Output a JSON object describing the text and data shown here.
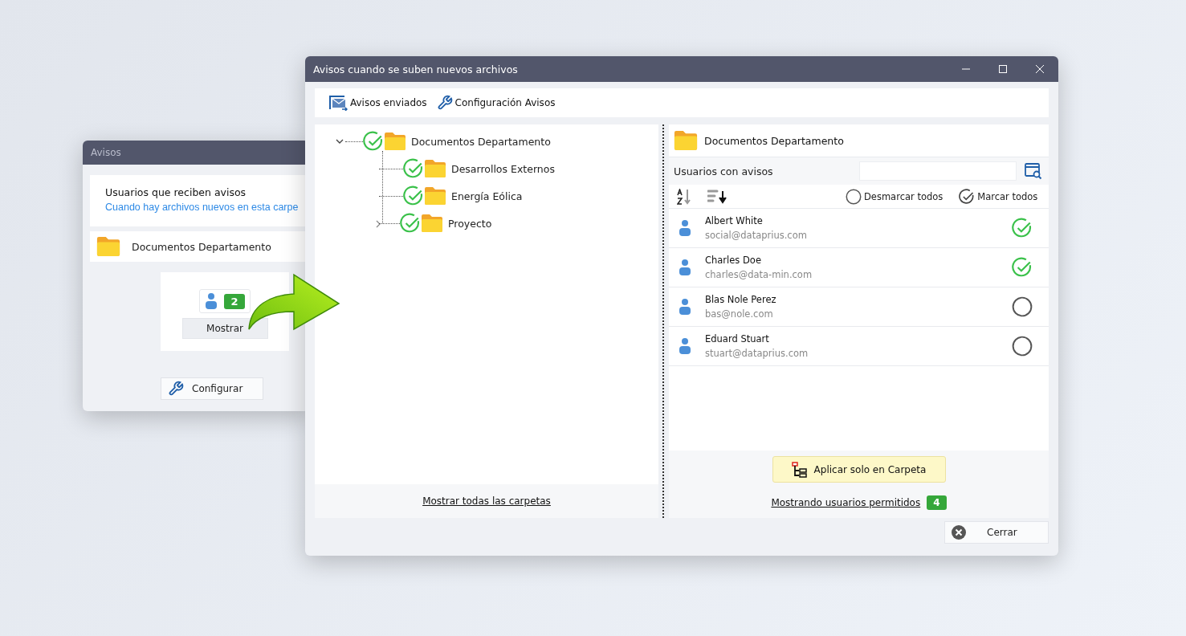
{
  "back_window": {
    "title": "Avisos",
    "heading": "Usuarios que reciben avisos",
    "subtitle": "Cuando hay archivos nuevos en esta carpe",
    "folder": "Documentos Departamento",
    "user_count": "2",
    "show_button": "Mostrar",
    "configure_button": "Configurar"
  },
  "window": {
    "title": "Avisos cuando se suben nuevos archivos"
  },
  "toolbar": [
    {
      "kind": "mail",
      "label": "Avisos enviados"
    },
    {
      "kind": "wrench",
      "label": "Configuración Avisos"
    }
  ],
  "tree": {
    "label": "Documentos Departamento",
    "checked": true,
    "has_children": true,
    "expanded": true,
    "children": [
      {
        "label": "Desarrollos Externos",
        "checked": true,
        "has_children": false,
        "expanded": false
      },
      {
        "label": "Energía Eólica",
        "checked": true,
        "has_children": false,
        "expanded": false
      },
      {
        "label": "Proyecto",
        "checked": true,
        "has_children": true,
        "expanded": false
      }
    ]
  },
  "show_all_link": "Mostrar todas las carpetas",
  "users_panel": {
    "folder": "Documentos Departamento",
    "label": "Usuarios con avisos",
    "uncheck_all": "Desmarcar todos",
    "check_all": "Marcar todos",
    "users": [
      {
        "name": "Albert White",
        "email": "social@dataprius.com",
        "checked": true
      },
      {
        "name": "Charles Doe",
        "email": "charles@data-min.com",
        "checked": true
      },
      {
        "name": "Blas Nole Perez",
        "email": "bas@nole.com",
        "checked": false
      },
      {
        "name": "Eduard Stuart",
        "email": "stuart@dataprius.com",
        "checked": false
      }
    ],
    "apply_button": "Aplicar solo en Carpeta",
    "showing_link": "Mostrando usuarios permitidos",
    "count": "4"
  },
  "close_button": "Cerrar"
}
